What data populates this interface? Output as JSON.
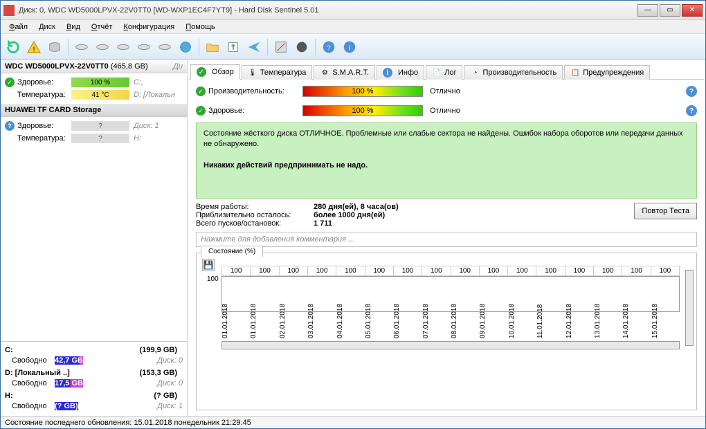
{
  "window": {
    "title": "Диск: 0, WDC WD5000LPVX-22V0TT0 [WD-WXP1EC4F7YT9]  -  Hard Disk Sentinel 5.01"
  },
  "menu": {
    "file": "Файл",
    "disk": "Диск",
    "view": "Вид",
    "report": "Отчёт",
    "config": "Конфигурация",
    "help": "Помощь"
  },
  "sidebar": {
    "dev1": {
      "name": "WDC WD5000LPVX-22V0TT0",
      "size": "(465,8 GB)",
      "health_label": "Здоровье:",
      "health_val": "100 %",
      "health_trail": "C:,",
      "temp_label": "Температура:",
      "temp_val": "41 °C",
      "temp_trail": "D: [Локальн"
    },
    "dev2": {
      "name": "HUAWEI  TF CARD Storage",
      "health_label": "Здоровье:",
      "health_val": "?",
      "health_trail": "Диск: 1",
      "temp_label": "Температура:",
      "temp_val": "?",
      "temp_trail": "H:"
    },
    "parts": [
      {
        "letter": "C:",
        "total": "(199,9 GB)",
        "free_label": "Свободно",
        "free_val": "42,7 GB",
        "trail": "Диск: 0",
        "barClass": "bluefree"
      },
      {
        "letter": "D: [Локальный ..]",
        "total": "(153,3 GB)",
        "free_label": "Свободно",
        "free_val": "17,5 GB",
        "trail": "Диск: 0",
        "barClass": "bluefree2"
      },
      {
        "letter": "H:",
        "total": "(? GB)",
        "free_label": "Свободно",
        "free_val": "(? GB)",
        "trail": "Диск: 1",
        "barClass": "blue"
      }
    ]
  },
  "tabs": [
    "Обзор",
    "Температура",
    "S.M.A.R.T.",
    "Инфо",
    "Лог",
    "Производительность",
    "Предупреждения"
  ],
  "main": {
    "perf_label": "Производительность:",
    "perf_val": "100 %",
    "perf_verdict": "Отлично",
    "health_label": "Здоровье:",
    "health_val": "100 %",
    "health_verdict": "Отлично",
    "greenbox_l1": "Состояние жёсткого диска ОТЛИЧНОЕ. Проблемные или слабые сектора не найдены. Ошибок набора оборотов или передачи данных не обнаружено.",
    "greenbox_l2": "Никаких действий предпринимать не надо.",
    "stats": {
      "uptime_l": "Время работы:",
      "uptime_v": "280 дня(ей), 8 часа(ов)",
      "remain_l": "Приблизительно осталось:",
      "remain_v": "более 1000 дня(ей)",
      "starts_l": "Всего пусков/остановок:",
      "starts_v": "1 711"
    },
    "retest": "Повтор Теста",
    "comment_ph": "Нажмите для добавления комментария ...",
    "chart_title": "Состояние (%)"
  },
  "chart_data": {
    "type": "line",
    "title": "Состояние (%)",
    "ylabel": "",
    "ylim": [
      0,
      100
    ],
    "categories": [
      "01.01.2018",
      "01.01.2018",
      "02.01.2018",
      "03.01.2018",
      "04.01.2018",
      "05.01.2018",
      "06.01.2018",
      "07.01.2018",
      "08.01.2018",
      "09.01.2018",
      "10.01.2018",
      "11.01.2018",
      "12.01.2018",
      "13.01.2018",
      "14.01.2018",
      "15.01.2018"
    ],
    "values": [
      100,
      100,
      100,
      100,
      100,
      100,
      100,
      100,
      100,
      100,
      100,
      100,
      100,
      100,
      100,
      100
    ]
  },
  "statusbar": "Состояние последнего обновления: 15.01.2018 понедельник 21:29:45"
}
